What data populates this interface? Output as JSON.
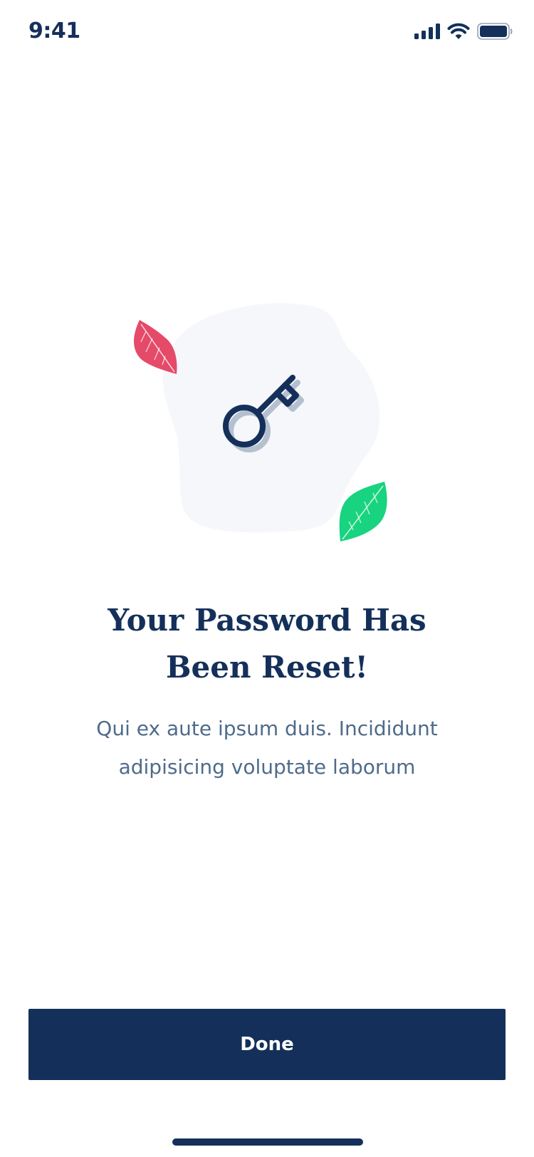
{
  "status_bar": {
    "time": "9:41",
    "icons": [
      "cellular-signal-icon",
      "wifi-icon",
      "battery-icon"
    ]
  },
  "illustration": {
    "icons": [
      "key-icon",
      "leaf-icon-red",
      "leaf-icon-green",
      "blob-background"
    ]
  },
  "message": {
    "title_line1": "Your Password Has",
    "title_line2": "Been Reset!",
    "body_line1": "Qui ex aute ipsum duis. Incididunt",
    "body_line2": "adipisicing voluptate laborum"
  },
  "actions": {
    "done_label": "Done"
  },
  "colors": {
    "primary": "#14305a",
    "body_text": "#4f6b8b",
    "blob": "#f5f7fb",
    "leaf_red": "#e54a68",
    "leaf_green": "#18d37f",
    "background": "#ffffff"
  }
}
